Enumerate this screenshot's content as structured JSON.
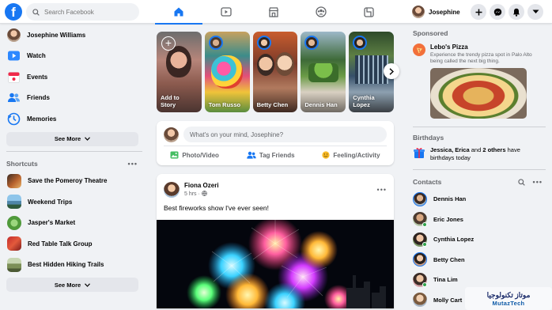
{
  "search": {
    "placeholder": "Search Facebook"
  },
  "header": {
    "user_name": "Josephine"
  },
  "left_nav": {
    "items": [
      {
        "label": "Josephine Williams",
        "icon": "avatar"
      },
      {
        "label": "Watch",
        "icon": "watch-icon"
      },
      {
        "label": "Events",
        "icon": "events-icon"
      },
      {
        "label": "Friends",
        "icon": "friends-icon"
      },
      {
        "label": "Memories",
        "icon": "memories-icon"
      }
    ],
    "see_more": "See More"
  },
  "shortcuts": {
    "title": "Shortcuts",
    "items": [
      {
        "label": "Save the Pomeroy Theatre"
      },
      {
        "label": "Weekend Trips"
      },
      {
        "label": "Jasper's Market"
      },
      {
        "label": "Red Table Talk Group"
      },
      {
        "label": "Best Hidden Hiking Trails"
      }
    ],
    "see_more": "See More"
  },
  "stories": [
    {
      "name": "Add to Story"
    },
    {
      "name": "Tom Russo"
    },
    {
      "name": "Betty Chen"
    },
    {
      "name": "Dennis Han"
    },
    {
      "name": "Cynthia Lopez"
    }
  ],
  "composer": {
    "placeholder": "What's on your mind, Josephine?",
    "actions": [
      "Photo/Video",
      "Tag Friends",
      "Feeling/Activity"
    ]
  },
  "post": {
    "author": "Fiona Ozeri",
    "time": "5 hrs",
    "text": "Best fireworks show I've ever seen!"
  },
  "sponsored": {
    "title": "Sponsored",
    "ad_name": "Lebo's Pizza",
    "ad_desc": "Experience the trendy pizza spot in Palo Alto being called the next big thing."
  },
  "birthdays": {
    "title": "Birthdays",
    "text_start": "Jessica, Erica",
    "text_and": " and ",
    "text_bold": "2 others",
    "text_end": " have birthdays today"
  },
  "contacts": {
    "title": "Contacts",
    "items": [
      "Dennis Han",
      "Eric Jones",
      "Cynthia Lopez",
      "Betty Chen",
      "Tina Lim",
      "Molly Cart"
    ]
  },
  "watermark": {
    "arabic": "موتاز تكنولوجيا",
    "latin": "MutazTech"
  },
  "colors": {
    "brand": "#1877f2",
    "background": "#f0f2f5",
    "online": "#31a24c"
  }
}
